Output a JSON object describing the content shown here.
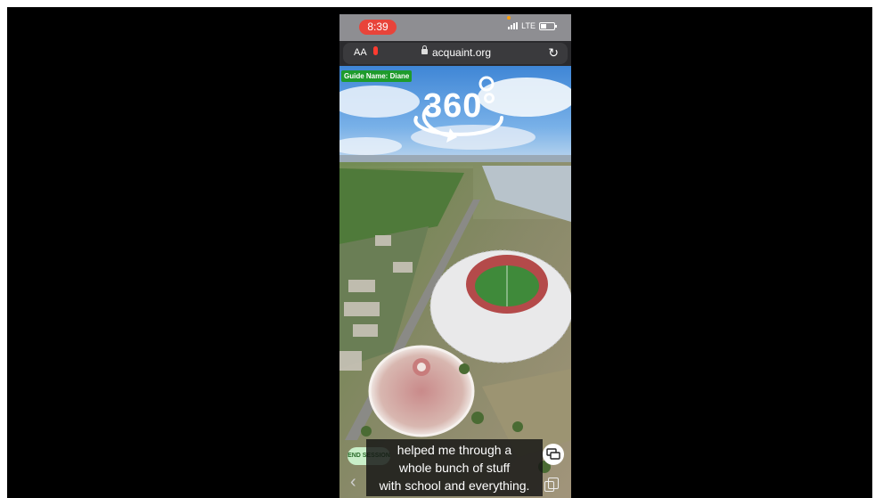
{
  "status_bar": {
    "time": "8:39",
    "network": "LTE"
  },
  "browser": {
    "text_size_label": "AA",
    "url": "acquaint.org"
  },
  "tour": {
    "guide_label": "Guide Name: Diane",
    "view_mode": "360°",
    "end_session_label": "END SESSION"
  },
  "caption": {
    "lines": [
      "helped me through a",
      "whole bunch of stuff",
      "with school and everything."
    ]
  },
  "icons": {
    "mic": "microphone-icon",
    "lock": "lock-icon",
    "reload": "reload-icon",
    "rotate": "rotate-360-icon",
    "chat": "chat-bubbles-icon",
    "back": "chevron-left-icon",
    "tabs": "tabs-icon"
  },
  "colors": {
    "time_pill": "#e8443a",
    "guide_badge": "#1e9b2c",
    "end_session_bg": "#c9efc9"
  }
}
